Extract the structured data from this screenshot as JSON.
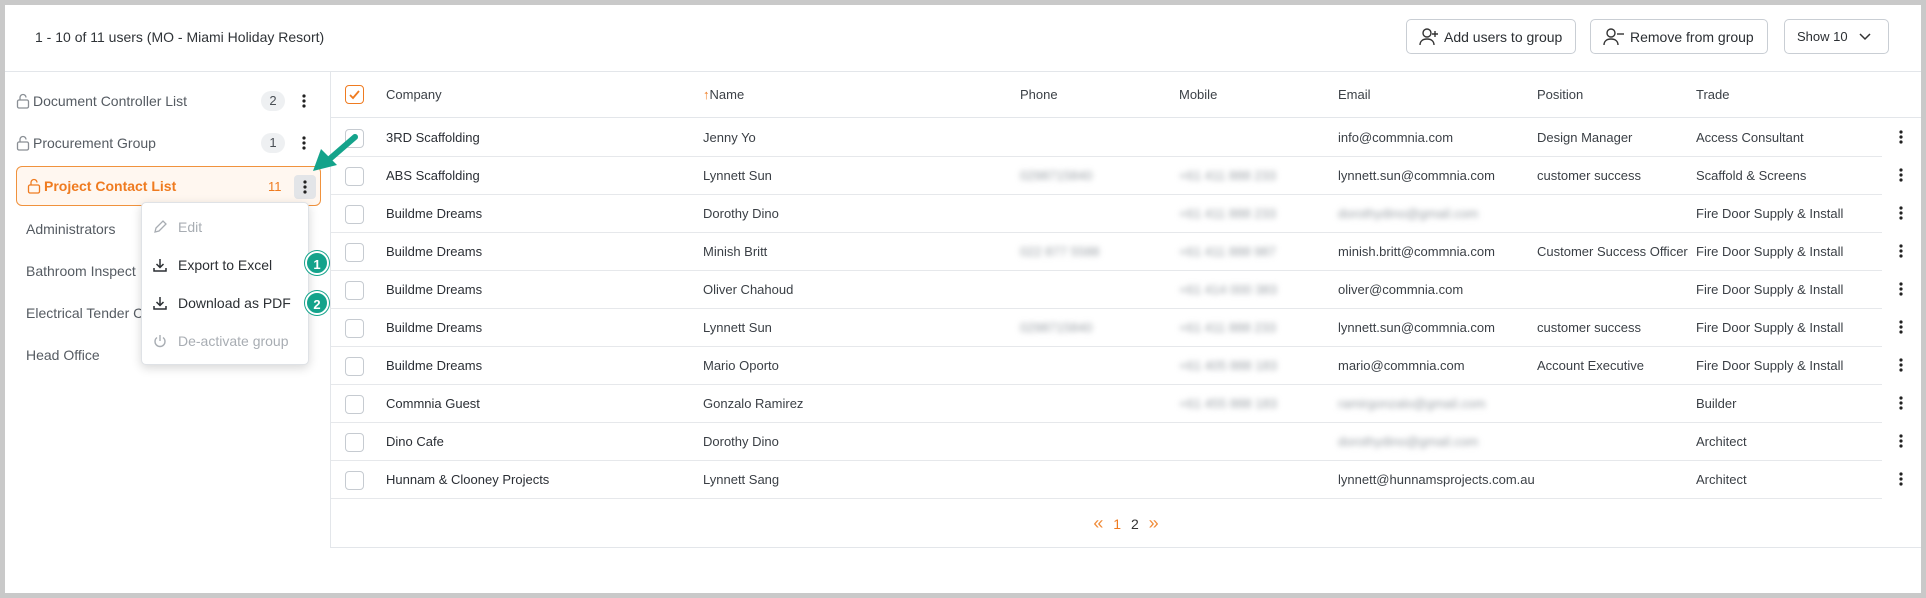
{
  "header": {
    "summary": "1 - 10 of 11 users (MO - Miami Holiday Resort)",
    "add_label": "Add users to group",
    "remove_label": "Remove from group",
    "show_label": "Show 10"
  },
  "groups": [
    {
      "label": "Document Controller List",
      "count": "2"
    },
    {
      "label": "Procurement Group",
      "count": "1"
    },
    {
      "label": "Project Contact List",
      "count": "11"
    }
  ],
  "plain_groups": [
    "Administrators",
    "Bathroom Inspect",
    "Electrical Tender C",
    "Head Office"
  ],
  "menu": {
    "edit": "Edit",
    "export_excel": "Export to Excel",
    "download_pdf": "Download as PDF",
    "deactivate": "De-activate group"
  },
  "steps": [
    "1",
    "2"
  ],
  "columns": {
    "company": "Company",
    "name_arrow": "↑",
    "name": "Name",
    "phone": "Phone",
    "mobile": "Mobile",
    "email": "Email",
    "position": "Position",
    "trade": "Trade"
  },
  "rows": [
    {
      "company": "3RD Scaffolding",
      "name": "Jenny Yo",
      "phone": "",
      "mobile": "",
      "email": "info@commnia.com",
      "position": "Design Manager",
      "trade": "Access Consultant"
    },
    {
      "company": "ABS Scaffolding",
      "name": "Lynnett Sun",
      "phone": "0298715840",
      "mobile": "+61 411 888 233",
      "email": "lynnett.sun@commnia.com",
      "position": "customer success",
      "trade": "Scaffold & Screens"
    },
    {
      "company": "Buildme Dreams",
      "name": "Dorothy Dino",
      "phone": "",
      "mobile": "+61 411 888 233",
      "email": "dorothydino@gmail.com",
      "position": "",
      "trade": "Fire Door Supply & Install"
    },
    {
      "company": "Buildme Dreams",
      "name": "Minish Britt",
      "phone": "022 877 5588",
      "mobile": "+61 411 888 987",
      "email": "minish.britt@commnia.com",
      "position": "Customer Success Officer",
      "trade": "Fire Door Supply & Install"
    },
    {
      "company": "Buildme Dreams",
      "name": "Oliver Chahoud",
      "phone": "",
      "mobile": "+61 414 000 383",
      "email": "oliver@commnia.com",
      "position": "",
      "trade": "Fire Door Supply & Install"
    },
    {
      "company": "Buildme Dreams",
      "name": "Lynnett Sun",
      "phone": "0298715840",
      "mobile": "+61 411 888 233",
      "email": "lynnett.sun@commnia.com",
      "position": "customer success",
      "trade": "Fire Door Supply & Install"
    },
    {
      "company": "Buildme Dreams",
      "name": "Mario Oporto",
      "phone": "",
      "mobile": "+61 405 888 183",
      "email": "mario@commnia.com",
      "position": "Account Executive",
      "trade": "Fire Door Supply & Install"
    },
    {
      "company": "Commnia Guest",
      "name": "Gonzalo Ramirez",
      "phone": "",
      "mobile": "+61 455 888 183",
      "email": "ramirgonzalo@gmail.com",
      "position": "",
      "trade": "Builder"
    },
    {
      "company": "Dino Cafe",
      "name": "Dorothy Dino",
      "phone": "",
      "mobile": "",
      "email": "dorothydino@gmail.com",
      "position": "",
      "trade": "Architect"
    },
    {
      "company": "Hunnam & Clooney Projects",
      "name": "Lynnett Sang",
      "phone": "",
      "mobile": "",
      "email": "lynnett@hunnamsprojects.com.au",
      "position": "",
      "trade": "Architect"
    }
  ],
  "pager": {
    "prev": "«",
    "page1": "1",
    "page2": "2",
    "next": "»"
  },
  "colors": {
    "accent": "#ef7b20",
    "step": "#14a38b"
  }
}
